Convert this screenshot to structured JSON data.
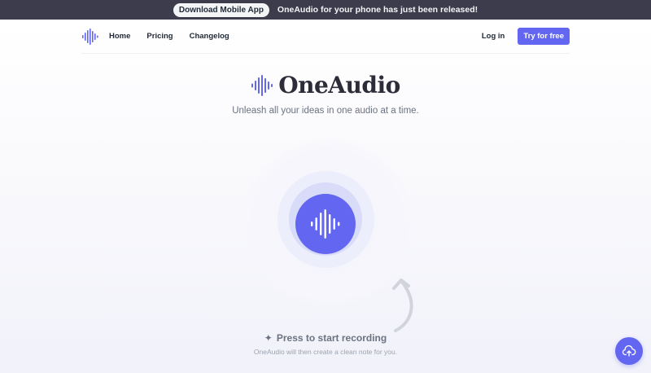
{
  "announcement": {
    "button_label": "Download Mobile App",
    "message": "OneAudio for your phone has just been released!"
  },
  "nav": {
    "logo_icon": "waveform-icon",
    "links": [
      {
        "label": "Home"
      },
      {
        "label": "Pricing"
      },
      {
        "label": "Changelog"
      }
    ],
    "login_label": "Log in",
    "cta_label": "Try for free"
  },
  "hero": {
    "brand_name": "OneAudio",
    "tagline": "Unleash all your ideas in one audio at a time."
  },
  "recorder": {
    "icon": "waveform-icon",
    "prompt_icon": "sparkle-icon",
    "prompt": "Press to start recording",
    "subtext": "OneAudio will then create a clean note for you."
  },
  "upload": {
    "icon": "upload-cloud-icon"
  },
  "colors": {
    "accent": "#6366f1",
    "announcement_bg": "#3c3c4c",
    "text_dark": "#1f2937",
    "text_muted": "#6b7280"
  }
}
